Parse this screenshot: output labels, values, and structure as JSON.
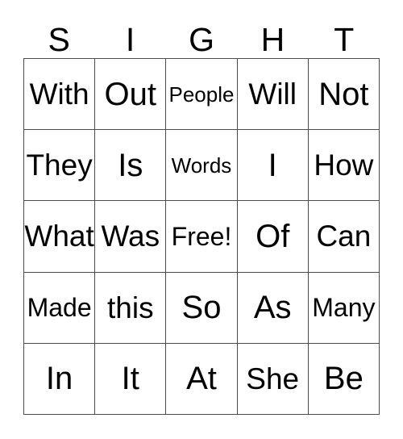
{
  "card": {
    "title_letters": [
      "S",
      "I",
      "G",
      "H",
      "T"
    ],
    "border_color": "#4d4d4d",
    "text_color": "#000000",
    "background_color": "#ffffff",
    "rows": [
      [
        {
          "label": "With",
          "size": "lg"
        },
        {
          "label": "Out",
          "size": "xl"
        },
        {
          "label": "People",
          "size": "sm"
        },
        {
          "label": "Will",
          "size": "lg"
        },
        {
          "label": "Not",
          "size": "xl"
        }
      ],
      [
        {
          "label": "They",
          "size": "lg"
        },
        {
          "label": "Is",
          "size": "xl"
        },
        {
          "label": "Words",
          "size": "sm"
        },
        {
          "label": "I",
          "size": "xl"
        },
        {
          "label": "How",
          "size": "lg"
        }
      ],
      [
        {
          "label": "What",
          "size": "lg"
        },
        {
          "label": "Was",
          "size": "lg"
        },
        {
          "label": "Free!",
          "size": "md"
        },
        {
          "label": "Of",
          "size": "xl"
        },
        {
          "label": "Can",
          "size": "lg"
        }
      ],
      [
        {
          "label": "Made",
          "size": "md"
        },
        {
          "label": "this",
          "size": "lg"
        },
        {
          "label": "So",
          "size": "xl"
        },
        {
          "label": "As",
          "size": "xl"
        },
        {
          "label": "Many",
          "size": "md"
        }
      ],
      [
        {
          "label": "In",
          "size": "xl"
        },
        {
          "label": "It",
          "size": "xl"
        },
        {
          "label": "At",
          "size": "xl"
        },
        {
          "label": "She",
          "size": "lg"
        },
        {
          "label": "Be",
          "size": "xl"
        }
      ]
    ]
  }
}
